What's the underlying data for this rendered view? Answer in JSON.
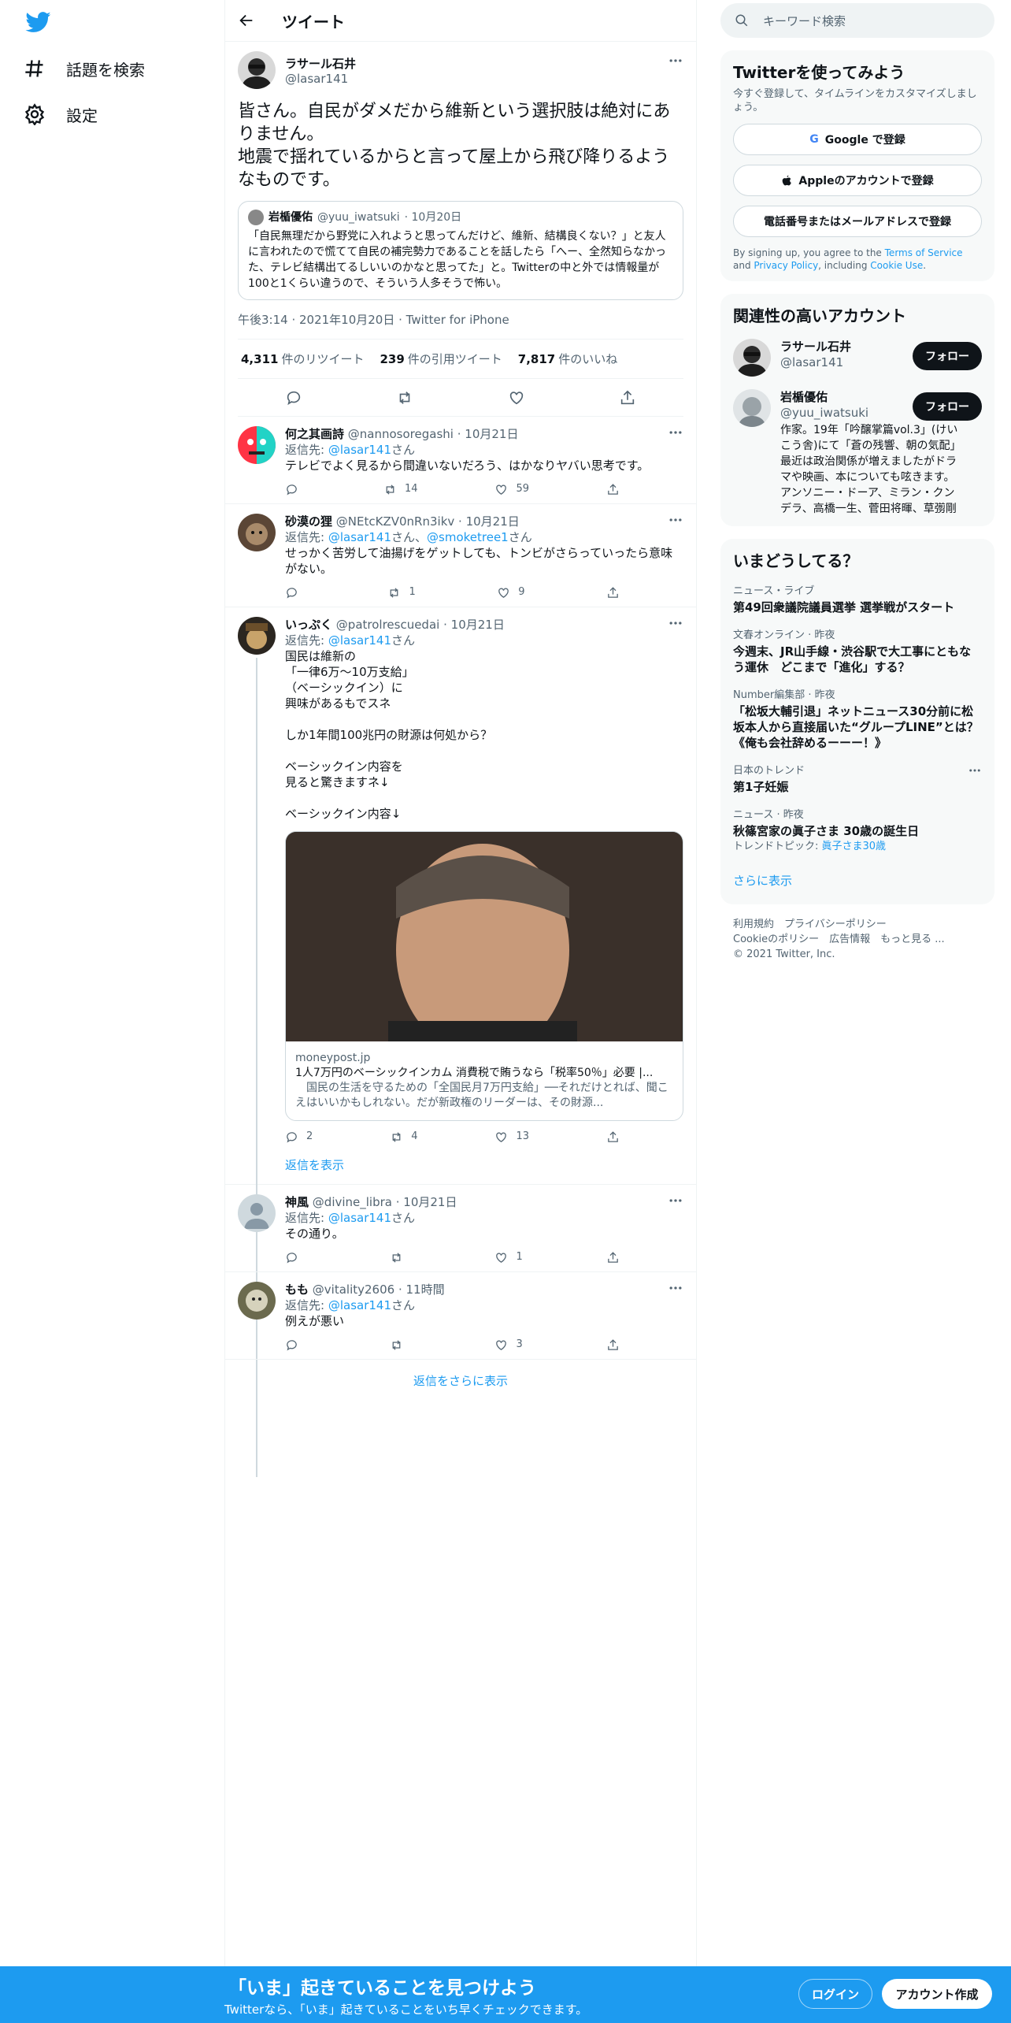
{
  "nav": {
    "explore": "話題を検索",
    "settings": "設定"
  },
  "header": {
    "title": "ツイート"
  },
  "tweet": {
    "name": "ラサール石井",
    "handle": "@lasar141",
    "text": "皆さん。自民がダメだから維新という選択肢は絶対にありません。\n地震で揺れているからと言って屋上から飛び降りるようなものです。",
    "quote": {
      "name": "岩楯優佑",
      "handle": "@yuu_iwatsuki",
      "date": "· 10月20日",
      "text": "「自民無理だから野党に入れようと思ってんだけど、維新、結構良くない？」と友人に言われたので慌てて自民の補完勢力であることを話したら「へー、全然知らなかった、テレビ結構出てるしいいのかなと思ってた」と。Twitterの中と外では情報量が100と1くらい違うので、そういう人多そうで怖い。"
    },
    "meta": "午後3:14 · 2021年10月20日 · Twitter for iPhone",
    "retweets": "4,311",
    "retweets_label": "件のリツイート",
    "quotes": "239",
    "quotes_label": "件の引用ツイート",
    "likes": "7,817",
    "likes_label": "件のいいね"
  },
  "replies": [
    {
      "name": "何之其画詩",
      "handle": "@nannosoregashi",
      "date": "· 10月21日",
      "reply_to_prefix": "返信先: ",
      "reply_to": "@lasar141",
      "reply_to_suffix": "さん",
      "text": "テレビでよく見るから間違いないだろう、はかなりヤバい思考です。",
      "rt": "14",
      "like": "59",
      "reply": ""
    },
    {
      "name": "砂漠の狸",
      "handle": "@NEtcKZV0nRn3ikv",
      "date": "· 10月21日",
      "reply_to_prefix": "返信先: ",
      "reply_to": "@lasar141",
      "reply_to_mid": "さん、",
      "reply_to2": "@smoketree1",
      "reply_to_suffix": "さん",
      "text": "せっかく苦労して油揚げをゲットしても、トンビがさらっていったら意味がない。",
      "rt": "1",
      "like": "9",
      "reply": ""
    },
    {
      "name": "いっぷく",
      "handle": "@patrolrescuedai",
      "date": "· 10月21日",
      "reply_to_prefix": "返信先: ",
      "reply_to": "@lasar141",
      "reply_to_suffix": "さん",
      "text": "国民は維新の\n「一律6万～10万支給」\n（ベーシックイン）に\n興味があるもでスネ\n\nしか1年間100兆円の財源は何処から？\n\nベーシックイン内容を\n見ると驚きますネ↓\n\nベーシックイン内容↓",
      "reply": "2",
      "rt": "4",
      "like": "13",
      "card": {
        "domain": "moneypost.jp",
        "title": "1人7万円のベーシックインカム 消費税で賄うなら「税率50％」必要 |...",
        "desc": "　国民の生活を守るための「全国民月7万円支給」──それだけとれば、聞こえはいいかもしれない。だが新政権のリーダーは、その財源..."
      },
      "show_replies": "返信を表示"
    },
    {
      "name": "神風",
      "handle": "@divine_libra",
      "date": "· 10月21日",
      "reply_to_prefix": "返信先: ",
      "reply_to": "@lasar141",
      "reply_to_suffix": "さん",
      "text": "その通り。",
      "reply": "",
      "rt": "",
      "like": "1"
    },
    {
      "name": "もも",
      "handle": "@vitality2606",
      "date": "· 11時間",
      "reply_to_prefix": "返信先: ",
      "reply_to": "@lasar141",
      "reply_to_suffix": "さん",
      "text": "例えが悪い",
      "reply": "",
      "rt": "",
      "like": "3"
    }
  ],
  "more_replies": "返信をさらに表示",
  "right": {
    "search_placeholder": "キーワード検索",
    "signup": {
      "title": "Twitterを使ってみよう",
      "sub": "今すぐ登録して、タイムラインをカスタマイズしましょう。",
      "google": "Google で登録",
      "apple": "Appleのアカウントで登録",
      "phone": "電話番号またはメールアドレスで登録",
      "terms_pre": "By signing up, you agree to the ",
      "terms": "Terms of Service",
      "and": " and ",
      "privacy": "Privacy Policy",
      "including": ", including ",
      "cookie": "Cookie Use",
      "dot": "."
    },
    "relevant": {
      "title": "関連性の高いアカウント",
      "follow": "フォロー",
      "accounts": [
        {
          "name": "ラサール石井",
          "handle": "@lasar141",
          "bio": ""
        },
        {
          "name": "岩楯優佑",
          "handle": "@yuu_iwatsuki",
          "bio": "作家。19年「吟醸掌篇vol.3」(けいこう舎)にて「蒼の残響、朝の気配」最近は政治関係が増えましたがドラマや映画、本についても呟きます。 アンソニー・ドーア、ミラン・クンデラ、高橋一生、菅田将暉、草彅剛"
        }
      ]
    },
    "trends": {
      "title": "いまどうしてる？",
      "items": [
        {
          "cat": "ニュース・ライブ",
          "title": "第49回衆議院議員選挙 選挙戦がスタート",
          "sub": ""
        },
        {
          "cat": "文春オンライン · 昨夜",
          "title": "今週末、JR山手線・渋谷駅で大工事にともなう運休　どこまで「進化」する？",
          "sub": ""
        },
        {
          "cat": "Number編集部 · 昨夜",
          "title": "「松坂大輔引退」ネットニュース30分前に松坂本人から直接届いた“グループLINE”とは？《俺も会社辞めるーーー！》",
          "sub": ""
        },
        {
          "cat": "日本のトレンド",
          "title": "第1子妊娠",
          "sub": ""
        },
        {
          "cat": "ニュース · 昨夜",
          "title": "秋篠宮家の眞子さま 30歳の誕生日",
          "sub_pre": "トレンドトピック: ",
          "sub": "眞子さま30歳"
        }
      ],
      "show_more": "さらに表示"
    },
    "footer": {
      "l1": "利用規約　プライバシーポリシー",
      "l2": "Cookieのポリシー　広告情報　もっと見る ...",
      "l3": "© 2021 Twitter, Inc."
    }
  },
  "bottom": {
    "title": "「いま」起きていることを見つけよう",
    "sub": "Twitterなら、「いま」起きていることをいち早くチェックできます。",
    "login": "ログイン",
    "signup": "アカウント作成"
  }
}
